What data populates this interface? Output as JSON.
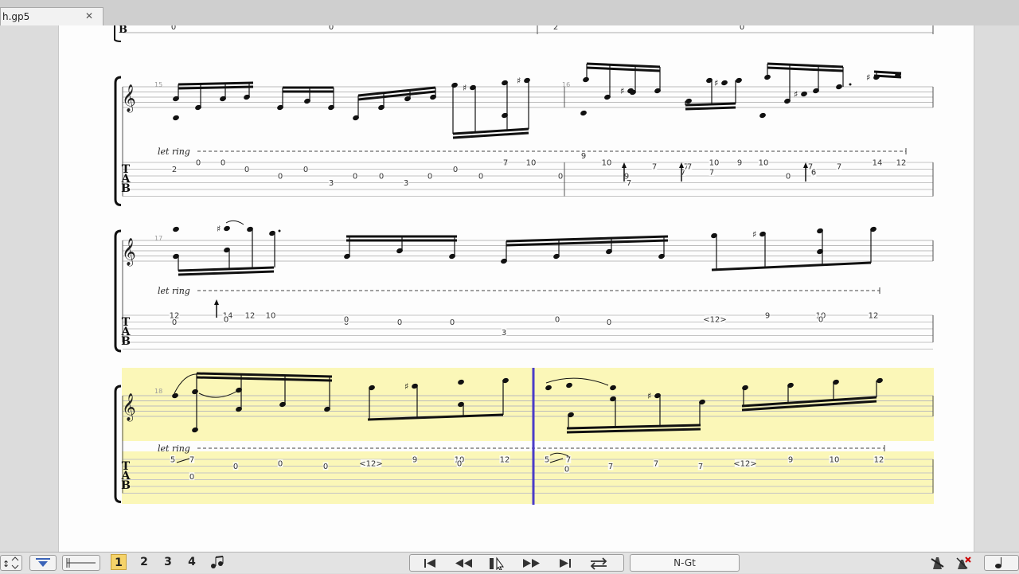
{
  "window": {
    "file_tab": "h.gp5",
    "close_glyph": "✕"
  },
  "score": {
    "measure_numbers": [
      "15",
      "16",
      "17",
      "18"
    ],
    "let_ring": "let ring",
    "tab_letters": [
      "T",
      "A",
      "B"
    ],
    "top_partial_b": "B",
    "top_partial_frets": [
      "0",
      "0",
      "2",
      "0"
    ],
    "systems": [
      {
        "string1": [
          [
            "12"
          ],
          [
            "14"
          ],
          [
            "12"
          ],
          [
            "10"
          ]
        ],
        "frets": [
          {
            "t": "2",
            "s": 1
          },
          {
            "t": "0",
            "s": 0
          },
          {
            "t": "0",
            "s": 0
          },
          {
            "t": "0",
            "s": 1
          },
          {
            "t": "0",
            "s": 2
          },
          {
            "t": "0",
            "s": 1
          },
          {
            "t": "3",
            "s": 3
          },
          {
            "t": "0",
            "s": 2
          },
          {
            "t": "0",
            "s": 2
          },
          {
            "t": "3",
            "s": 3
          },
          {
            "t": "0",
            "s": 2
          },
          {
            "t": "0",
            "s": 1
          },
          {
            "t": "0",
            "s": 2
          },
          {
            "t": "8",
            "s": 0
          },
          {
            "t": "7",
            "s": 0
          },
          {
            "t": "10",
            "s": 0
          },
          {
            "t": "0",
            "s": 2
          },
          {
            "t": "9",
            "s": -1
          },
          {
            "t": "10",
            "s": 0
          },
          {
            "t": "9",
            "s": 2
          },
          {
            "t": "7",
            "s": 3
          },
          {
            "t": "7",
            "s": 0.6
          },
          {
            "t": "7",
            "s": 1.4
          },
          {
            "t": "7",
            "s": 0.6
          },
          {
            "t": "7",
            "s": 0.6
          },
          {
            "t": "7",
            "s": 1.4
          },
          {
            "t": "10",
            "s": 0
          },
          {
            "t": "9",
            "s": 0
          },
          {
            "t": "10",
            "s": 0
          },
          {
            "t": "0",
            "s": 2
          },
          {
            "t": "7",
            "s": 1.6
          },
          {
            "t": "7",
            "s": 0.6
          },
          {
            "t": "6",
            "s": 1.4
          },
          {
            "t": "7",
            "s": 0.6
          },
          {
            "t": "14",
            "s": 0
          },
          {
            "t": "12",
            "s": 0
          }
        ]
      },
      {
        "frets": [
          {
            "t": "12",
            "s": 0
          },
          {
            "t": "0",
            "s": 1
          },
          {
            "t": "14",
            "s": 0
          },
          {
            "t": "0",
            "s": 0.6
          },
          {
            "t": "12",
            "s": 0
          },
          {
            "t": "10",
            "s": 0
          },
          {
            "t": "0",
            "s": 1
          },
          {
            "t": "0",
            "s": 0.6
          },
          {
            "t": "0",
            "s": 1
          },
          {
            "t": "3",
            "s": 2.5
          },
          {
            "t": "0",
            "s": 1
          },
          {
            "t": "0",
            "s": 0.6
          },
          {
            "t": "0",
            "s": 1
          },
          {
            "t": "<12>",
            "s": 0.6
          },
          {
            "t": "9",
            "s": 0
          },
          {
            "t": "10",
            "s": 0
          },
          {
            "t": "0",
            "s": 0.6
          },
          {
            "t": "12",
            "s": 0
          }
        ]
      },
      {
        "frets": [
          {
            "t": "5",
            "s": 0
          },
          {
            "t": "7",
            "s": 0
          },
          {
            "t": "0",
            "s": 1
          },
          {
            "t": "0",
            "s": 0.6
          },
          {
            "t": "0",
            "s": 1
          },
          {
            "t": "0",
            "s": 2.5
          },
          {
            "t": "<12>",
            "s": 0.6
          },
          {
            "t": "9",
            "s": 0
          },
          {
            "t": "10",
            "s": 0
          },
          {
            "t": "0",
            "s": 0.6
          },
          {
            "t": "12",
            "s": 0
          },
          {
            "t": "5",
            "s": 0
          },
          {
            "t": "7",
            "s": 0
          },
          {
            "t": "0",
            "s": 1.4
          },
          {
            "t": "7",
            "s": 1
          },
          {
            "t": "7",
            "s": 0.6
          },
          {
            "t": "7",
            "s": 1
          },
          {
            "t": "<12>",
            "s": 0.6
          },
          {
            "t": "9",
            "s": 0
          },
          {
            "t": "10",
            "s": 0
          },
          {
            "t": "12",
            "s": 0
          }
        ]
      }
    ]
  },
  "toolbar": {
    "tracks": [
      "1",
      "2",
      "3",
      "4"
    ],
    "active_track": "1",
    "track_name": "N-Gt",
    "transport": [
      "first-icon",
      "rewind-icon",
      "play-pause-icon",
      "forward-icon",
      "last-icon",
      "loop-icon"
    ]
  },
  "colors": {
    "highlight": "#fbf7b8",
    "cursor": "#4b3cc8",
    "ink": "#111111"
  }
}
